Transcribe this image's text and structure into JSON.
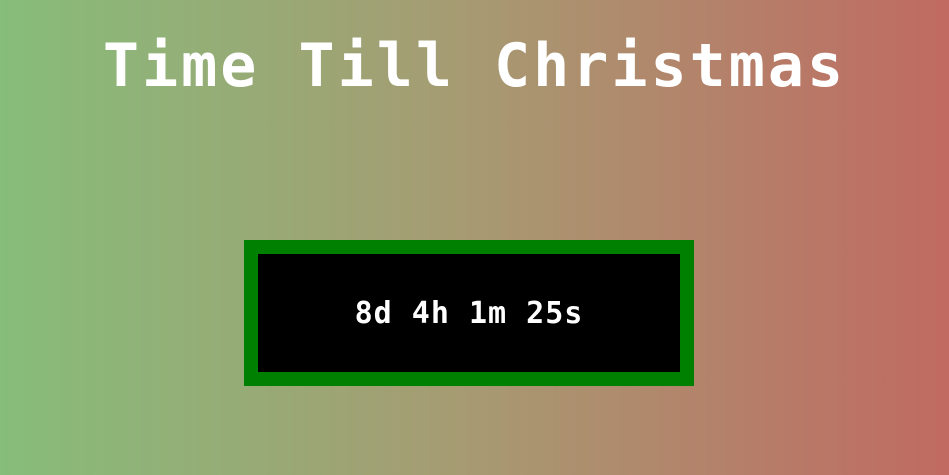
{
  "page": {
    "title": "Time Till Christmas",
    "countdown": "8d 4h 1m 25s"
  },
  "colors": {
    "gradient_left": "#86bd7a",
    "gradient_right": "#c06a62",
    "box_border": "#008000",
    "box_background": "#000000",
    "text": "#ffffff"
  }
}
